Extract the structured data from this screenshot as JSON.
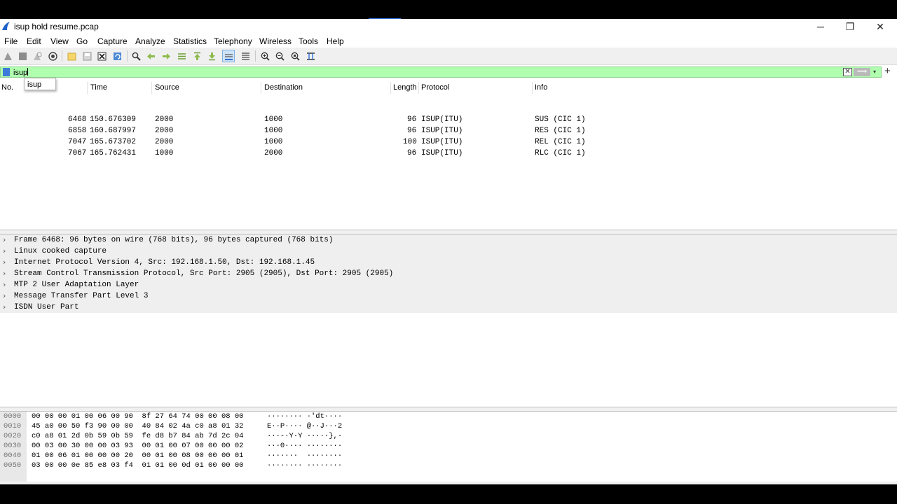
{
  "window": {
    "title": "isup hold resume.pcap"
  },
  "window_controls": {
    "minimize": "─",
    "maximize": "❐",
    "close": "✕"
  },
  "menu": [
    "File",
    "Edit",
    "View",
    "Go",
    "Capture",
    "Analyze",
    "Statistics",
    "Telephony",
    "Wireless",
    "Tools",
    "Help"
  ],
  "toolbar_icons": [
    "start-capture-icon",
    "stop-capture-icon",
    "restart-capture-icon",
    "capture-options-icon",
    "open-file-icon",
    "save-file-icon",
    "close-file-icon",
    "reload-file-icon",
    "find-packet-icon",
    "go-back-icon",
    "go-forward-icon",
    "go-to-packet-icon",
    "go-first-icon",
    "go-last-icon",
    "autoscroll-icon",
    "colorize-icon",
    "zoom-in-icon",
    "zoom-out-icon",
    "normal-size-icon",
    "resize-columns-icon"
  ],
  "filter": {
    "value": "isup",
    "autocomplete": "isup",
    "clear_glyph": "✕",
    "apply_glyph": "⟹",
    "dropdown_glyph": "▾",
    "add_glyph": "+"
  },
  "packet_list": {
    "columns": [
      "No.",
      "Time",
      "Source",
      "Destination",
      "Length",
      "Protocol",
      "Info"
    ],
    "rows": [
      {
        "no": "6468",
        "time": "150.676309",
        "source": "2000",
        "destination": "1000",
        "length": "96",
        "protocol": "ISUP(ITU)",
        "info": "SUS (CIC 1)"
      },
      {
        "no": "6858",
        "time": "160.687997",
        "source": "2000",
        "destination": "1000",
        "length": "96",
        "protocol": "ISUP(ITU)",
        "info": "RES (CIC 1)"
      },
      {
        "no": "7047",
        "time": "165.673702",
        "source": "2000",
        "destination": "1000",
        "length": "100",
        "protocol": "ISUP(ITU)",
        "info": "REL (CIC 1)"
      },
      {
        "no": "7067",
        "time": "165.762431",
        "source": "1000",
        "destination": "2000",
        "length": "96",
        "protocol": "ISUP(ITU)",
        "info": "RLC (CIC 1)"
      }
    ]
  },
  "details": {
    "expander_glyph": "›",
    "rows": [
      "Frame 6468: 96 bytes on wire (768 bits), 96 bytes captured (768 bits)",
      "Linux cooked capture",
      "Internet Protocol Version 4, Src: 192.168.1.50, Dst: 192.168.1.45",
      "Stream Control Transmission Protocol, Src Port: 2905 (2905), Dst Port: 2905 (2905)",
      "MTP 2 User Adaptation Layer",
      "Message Transfer Part Level 3",
      "ISDN User Part"
    ]
  },
  "hex": {
    "rows": [
      {
        "offset": "0000",
        "bytes": "00 00 00 01 00 06 00 90  8f 27 64 74 00 00 08 00",
        "ascii": "········ ·'dt····"
      },
      {
        "offset": "0010",
        "bytes": "45 a0 00 50 f3 90 00 00  40 84 02 4a c0 a8 01 32",
        "ascii": "E··P···· @··J···2"
      },
      {
        "offset": "0020",
        "bytes": "c0 a8 01 2d 0b 59 0b 59  fe d8 b7 84 ab 7d 2c 04",
        "ascii": "···-·Y·Y ·····},·"
      },
      {
        "offset": "0030",
        "bytes": "00 03 00 30 00 00 03 93  00 01 00 07 00 00 00 02",
        "ascii": "···0···· ········"
      },
      {
        "offset": "0040",
        "bytes": "01 00 06 01 00 00 00 20  00 01 00 08 00 00 00 01",
        "ascii": "·······  ········"
      },
      {
        "offset": "0050",
        "bytes": "03 00 00 0e 85 e8 03 f4  01 01 00 0d 01 00 00 00",
        "ascii": "········ ········"
      }
    ]
  }
}
